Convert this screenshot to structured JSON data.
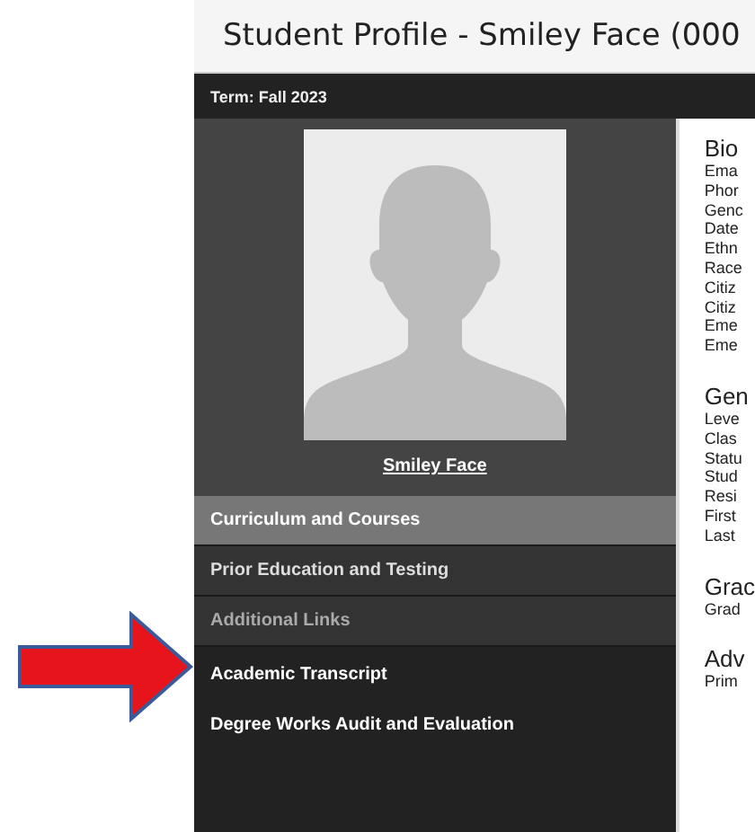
{
  "window": {
    "title": "Student Profile - Smiley Face (000"
  },
  "term_bar": {
    "label": "Term:",
    "value": "Fall 2023"
  },
  "profile": {
    "name": "Smiley Face"
  },
  "nav_sections": [
    {
      "label": "Curriculum and Courses",
      "kind": "section",
      "selected": true
    },
    {
      "label": "Prior Education and Testing",
      "kind": "section",
      "selected": false
    },
    {
      "label": "Additional Links",
      "kind": "group"
    }
  ],
  "links": [
    "Academic Transcript",
    "Degree Works Audit and Evaluation"
  ],
  "details": [
    {
      "heading": "Bio",
      "fields": [
        "Ema",
        "Phor",
        "Genc",
        "Date",
        "Ethn",
        "Race",
        "Citiz",
        "Citiz",
        "Eme",
        "Eme"
      ]
    },
    {
      "heading": "Gen",
      "fields": [
        "Leve",
        "Clas",
        "Statu",
        "Stud",
        "Resi",
        "First",
        "Last"
      ]
    },
    {
      "heading": "Grac",
      "fields": [
        "Grad"
      ]
    },
    {
      "heading": "Adv",
      "fields": [
        "Prim"
      ]
    }
  ]
}
